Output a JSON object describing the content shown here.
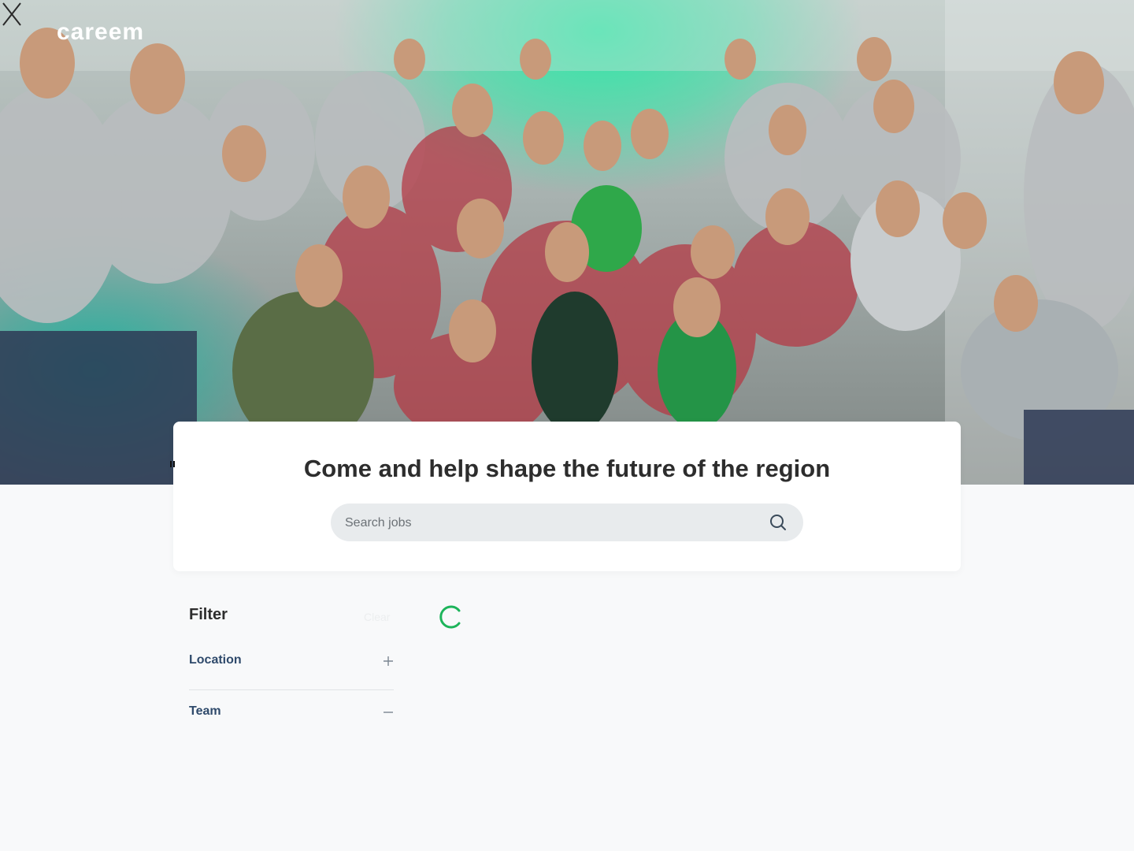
{
  "brand": {
    "logo_text": "careem",
    "accent": "#1db45a"
  },
  "hero": {
    "photo_description_icon": "team-photo",
    "close_icon": "close-icon"
  },
  "search_card": {
    "heading": "Come and help shape the future of the region",
    "search_placeholder": "Search jobs",
    "search_value": ""
  },
  "filter": {
    "title": "Filter",
    "clear_label": "Clear",
    "groups": [
      {
        "label": "Location",
        "state_icon": "plus-icon"
      },
      {
        "label": "Team",
        "state_icon": "minus-icon"
      }
    ]
  },
  "results": {
    "loading": true,
    "spinner_color": "#1db45a"
  }
}
